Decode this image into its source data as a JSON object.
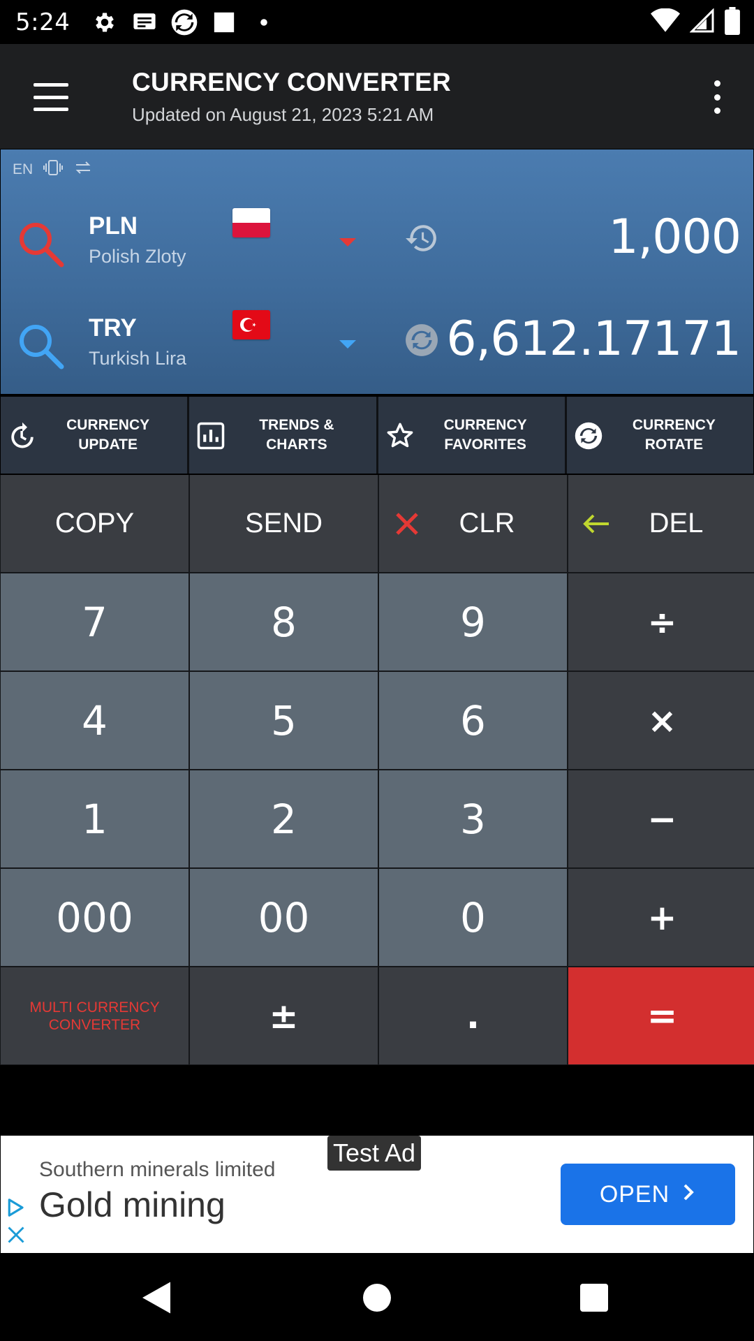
{
  "status_bar": {
    "time": "5:24",
    "icons_left": [
      "settings-icon",
      "message-icon",
      "sync-app-icon",
      "square-app-icon",
      "dot-icon"
    ],
    "icons_right": [
      "wifi-icon",
      "signal-icon",
      "battery-icon"
    ]
  },
  "app_bar": {
    "title": "CURRENCY CONVERTER",
    "subtitle": "Updated on August 21, 2023 5:21 AM"
  },
  "converter": {
    "language": "EN",
    "from": {
      "code": "PLN",
      "name": "Polish Zloty",
      "amount": "1,000",
      "caret_color": "#e53935",
      "search_color": "#e53935"
    },
    "to": {
      "code": "TRY",
      "name": "Turkish Lira",
      "amount": "6,612.17171",
      "caret_color": "#42a5f5",
      "search_color": "#42a5f5"
    }
  },
  "shortcuts": [
    {
      "label_line1": "CURRENCY",
      "label_line2": "UPDATE",
      "icon": "refresh-clock-icon"
    },
    {
      "label_line1": "TRENDS &",
      "label_line2": "CHARTS",
      "icon": "bar-chart-icon"
    },
    {
      "label_line1": "CURRENCY",
      "label_line2": "FAVORITES",
      "icon": "star-icon"
    },
    {
      "label_line1": "CURRENCY",
      "label_line2": "ROTATE",
      "icon": "rotate-icon"
    }
  ],
  "keypad": {
    "copy": "COPY",
    "send": "SEND",
    "clr": "CLR",
    "del": "DEL",
    "k7": "7",
    "k8": "8",
    "k9": "9",
    "div": "÷",
    "k4": "4",
    "k5": "5",
    "k6": "6",
    "mul": "×",
    "k1": "1",
    "k2": "2",
    "k3": "3",
    "sub": "−",
    "k000": "000",
    "k00": "00",
    "k0": "0",
    "add": "+",
    "multi_line1": "MULTI CURRENCY",
    "multi_line2": "CONVERTER",
    "plusminus": "±",
    "dot": ".",
    "equals": "="
  },
  "ad": {
    "tag": "Test Ad",
    "advertiser": "Southern minerals limited",
    "headline": "Gold mining",
    "button": "OPEN"
  },
  "colors": {
    "accent_red": "#d32f2f",
    "panel_blue": "#4b7cb0",
    "ad_button": "#1a73e8"
  }
}
